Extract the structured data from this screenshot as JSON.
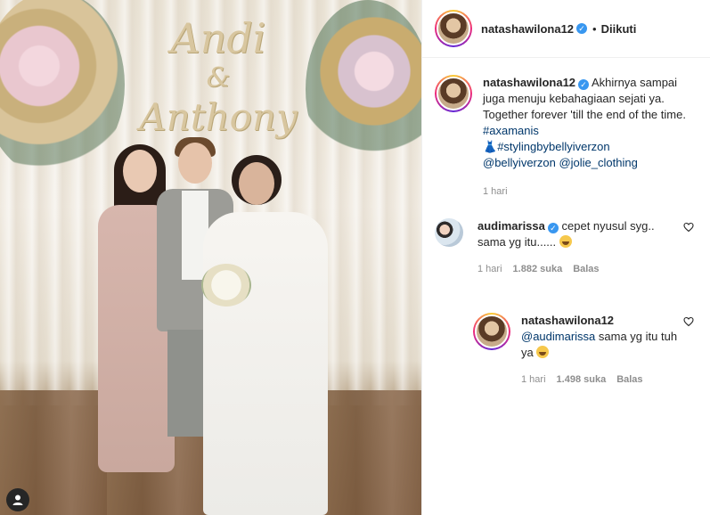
{
  "post": {
    "photo": {
      "sign_line1": "Andi",
      "sign_line2": "&",
      "sign_line3": "Anthony"
    },
    "header": {
      "username": "natashawilona12",
      "separator": "•",
      "follow_label": "Diikuti"
    },
    "caption": {
      "username": "natashawilona12",
      "text": "Akhirnya sampai juga menuju kebahagiaan sejati ya. Together forever 'till the end of the time.",
      "hashtag1": "#axamanis",
      "hashtag2": "#stylingbybellyiverzon",
      "mention1": "@bellyiverzon",
      "mention2": "@jolie_clothing",
      "time": "1 hari"
    },
    "comments": [
      {
        "username": "audimarissa",
        "text": "cepet nyusul syg.. sama yg itu......",
        "time": "1 hari",
        "likes": "1.882 suka",
        "reply_label": "Balas"
      }
    ],
    "reply": {
      "username": "natashawilona12",
      "mention": "@audimarissa",
      "text": "sama yg itu tuh ya",
      "time": "1 hari",
      "likes": "1.498 suka",
      "reply_label": "Balas"
    }
  }
}
